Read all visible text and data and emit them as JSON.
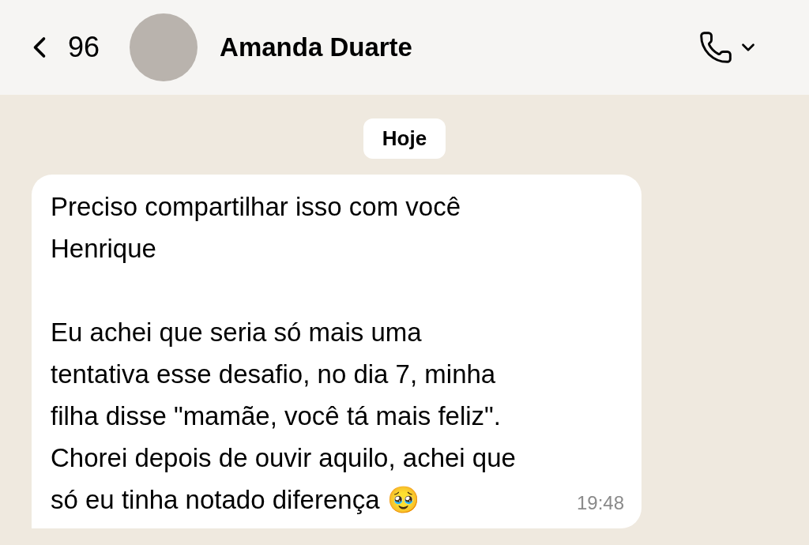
{
  "header": {
    "back_count": "96",
    "contact_name": "Amanda Duarte"
  },
  "date_chip": "Hoje",
  "message": {
    "paragraphs": [
      [
        "Preciso compartilhar isso com você",
        "Henrique"
      ],
      [
        "Eu achei que seria só mais uma",
        "tentativa esse desafio, no dia 7, minha",
        "filha disse \"mamãe, você tá mais feliz\".",
        "Chorei depois de ouvir aquilo, achei que",
        "só eu tinha notado diferença 🥹"
      ]
    ],
    "time": "19:48"
  }
}
